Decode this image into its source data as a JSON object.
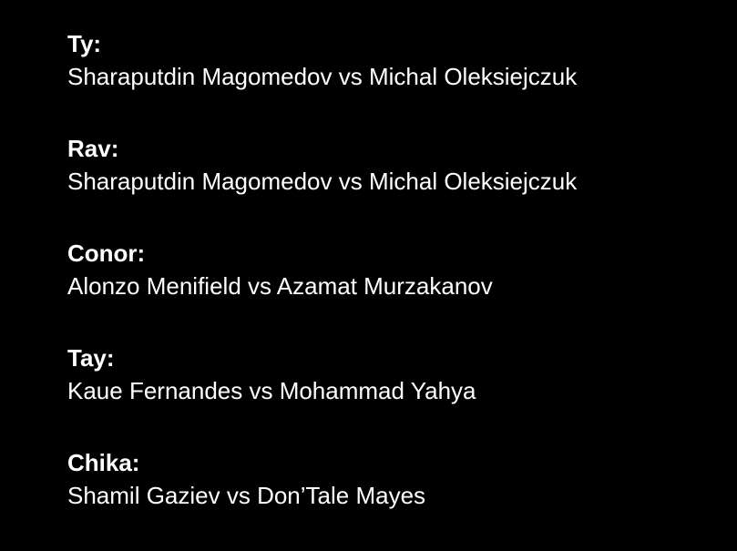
{
  "picks": [
    {
      "name": "Ty:",
      "fight": "Sharaputdin Magomedov vs Michal Oleksiejczuk"
    },
    {
      "name": "Rav:",
      "fight": "Sharaputdin Magomedov vs Michal Oleksiejczuk"
    },
    {
      "name": "Conor:",
      "fight": "Alonzo Menifield vs Azamat Murzakanov"
    },
    {
      "name": "Tay:",
      "fight": "Kaue Fernandes vs Mohammad Yahya"
    },
    {
      "name": "Chika:",
      "fight": "Shamil Gaziev vs Don’Tale Mayes"
    }
  ]
}
